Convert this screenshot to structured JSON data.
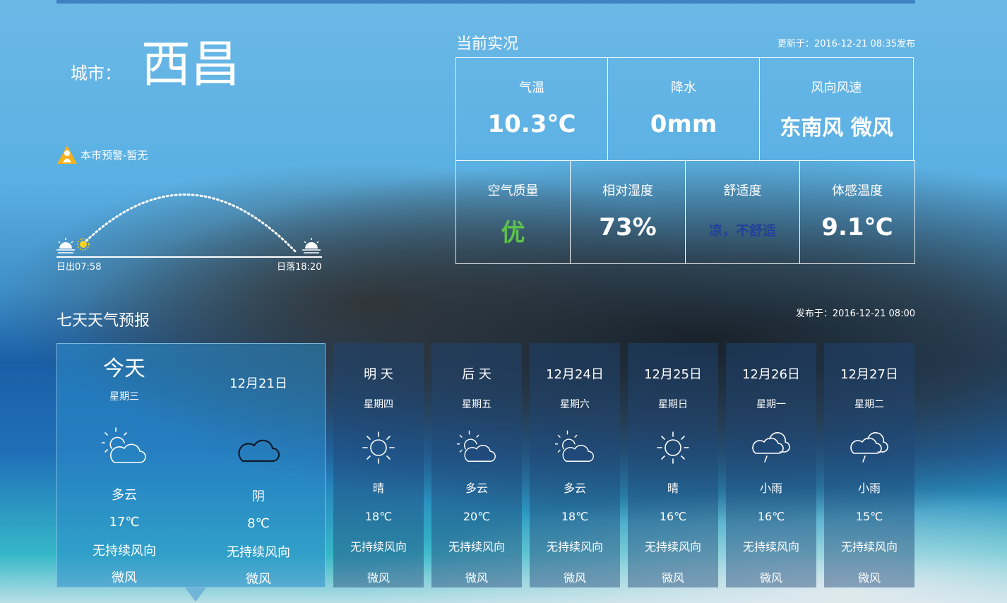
{
  "city": {
    "label": "城市：",
    "name": "西昌"
  },
  "warning": {
    "text": "本市预警-暂无",
    "color": "#f5b21d"
  },
  "sun": {
    "sunrise": "日出07:58",
    "sunset": "日落18:20"
  },
  "current": {
    "title": "当前实况",
    "updated": "更新于：2016-12-21 08:35发布",
    "temp": {
      "label": "气温",
      "value": "10.3℃"
    },
    "precip": {
      "label": "降水",
      "value": "0mm"
    },
    "wind": {
      "label": "风向风速",
      "value": "东南风 微风"
    },
    "aqi": {
      "label": "空气质量",
      "value": "优",
      "color": "#5dc04b"
    },
    "humidity": {
      "label": "相对湿度",
      "value": "73%"
    },
    "comfort": {
      "label": "舒适度",
      "value": "凉，不舒适",
      "color": "#23409a"
    },
    "feels": {
      "label": "体感温度",
      "value": "9.1℃"
    }
  },
  "forecast": {
    "title": "七天天气预报",
    "published": "发布于：2016-12-21 08:00",
    "today": {
      "day": "今天",
      "week": "星期三",
      "date": "12月21日",
      "day_icon": "partly-cloudy-icon",
      "night_icon": "cloudy-icon",
      "day_weather": "多云",
      "day_temp": "17℃",
      "day_wind": "无持续风向",
      "day_windlvl": "微风",
      "night_weather": "阴",
      "night_temp": "8℃",
      "night_wind": "无持续风向",
      "night_windlvl": "微风"
    },
    "days": [
      {
        "name": "明 天",
        "week": "星期四",
        "icon": "sunny-icon",
        "weather": "晴",
        "temp": "18℃",
        "wind": "无持续风向",
        "windlvl": "微风"
      },
      {
        "name": "后 天",
        "week": "星期五",
        "icon": "partly-cloudy-icon",
        "weather": "多云",
        "temp": "20℃",
        "wind": "无持续风向",
        "windlvl": "微风"
      },
      {
        "name": "12月24日",
        "week": "星期六",
        "icon": "partly-cloudy-icon",
        "weather": "多云",
        "temp": "18℃",
        "wind": "无持续风向",
        "windlvl": "微风"
      },
      {
        "name": "12月25日",
        "week": "星期日",
        "icon": "sunny-icon",
        "weather": "晴",
        "temp": "16℃",
        "wind": "无持续风向",
        "windlvl": "微风"
      },
      {
        "name": "12月26日",
        "week": "星期一",
        "icon": "light-rain-icon",
        "weather": "小雨",
        "temp": "16℃",
        "wind": "无持续风向",
        "windlvl": "微风"
      },
      {
        "name": "12月27日",
        "week": "星期二",
        "icon": "light-rain-icon",
        "weather": "小雨",
        "temp": "15℃",
        "wind": "无持续风向",
        "windlvl": "微风"
      }
    ]
  }
}
